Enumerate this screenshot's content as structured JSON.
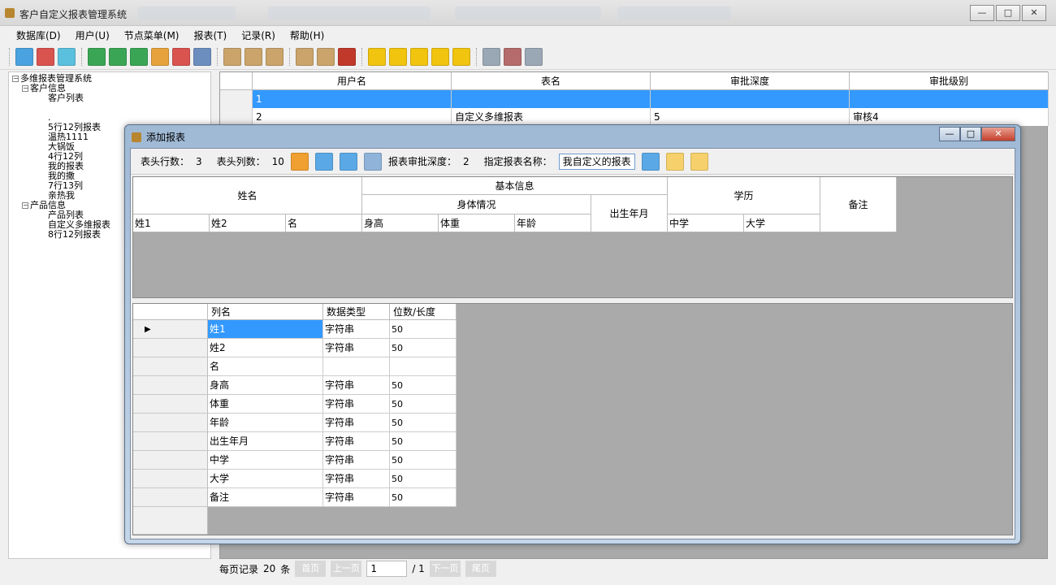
{
  "window": {
    "title": "客户自定义报表管理系统"
  },
  "menu": [
    "数据库(D)",
    "用户(U)",
    "节点菜单(M)",
    "报表(T)",
    "记录(R)",
    "帮助(H)"
  ],
  "toolbar_icons": [
    "add-table-icon",
    "delete-table-icon",
    "edit-table-icon",
    "add-node-icon",
    "add-child-node-icon",
    "add-sibling-node-icon",
    "move-node-icon",
    "delete-node-icon",
    "save-node-icon",
    "add-user-icon",
    "edit-user-icon",
    "delete-user-icon",
    "user-permission-icon",
    "user-role-icon",
    "import-icon",
    "report-add-icon",
    "report-edit-icon",
    "report-view-icon",
    "report-delete-icon",
    "report-export-icon",
    "db-connect-icon",
    "db-delete-icon",
    "db-edit-icon"
  ],
  "tree": {
    "root": "多维报表管理系统",
    "groups": [
      {
        "label": "客户信息",
        "items": [
          "客户列表",
          "",
          ".",
          "5行12列报表",
          "温热1111",
          "大锅饭",
          "4行12列",
          "我的报表",
          "我的撒",
          "7行13列",
          "亲热我"
        ]
      },
      {
        "label": "产品信息",
        "items": [
          "产品列表",
          "自定义多维报表",
          "8行12列报表"
        ]
      }
    ]
  },
  "main_grid": {
    "headers": [
      "用户名",
      "表名",
      "审批深度",
      "审批级别"
    ],
    "rows": [
      [
        "1",
        "",
        "",
        ""
      ],
      [
        "2",
        "自定义多维报表",
        "5",
        "审核4"
      ]
    ]
  },
  "pager": {
    "per_page_label": "每页记录",
    "per_page": "20",
    "unit": "条",
    "first": "首页",
    "prev": "上一页",
    "page": "1",
    "total": "/ 1",
    "next": "下一页",
    "last": "尾页"
  },
  "dialog": {
    "title": "添加报表",
    "rows_label": "表头行数：",
    "rows_value": "3",
    "cols_label": "表头列数：",
    "cols_value": "10",
    "depth_label": "报表审批深度：",
    "depth_value": "2",
    "name_label": "指定报表名称：",
    "name_value": "我自定义的报表",
    "header_preview": {
      "name": "姓名",
      "basic": "基本信息",
      "body": "身体情况",
      "birth": "出生年月",
      "edu": "学历",
      "note": "备注",
      "leaf": [
        "姓1",
        "姓2",
        "名",
        "身高",
        "体重",
        "年龄",
        "中学",
        "大学"
      ]
    },
    "columns_grid": {
      "headers": [
        "列名",
        "数据类型",
        "位数/长度"
      ],
      "rows": [
        [
          "姓1",
          "字符串",
          "50"
        ],
        [
          "姓2",
          "字符串",
          "50"
        ],
        [
          "名",
          "",
          ""
        ],
        [
          "身高",
          "字符串",
          "50"
        ],
        [
          "体重",
          "字符串",
          "50"
        ],
        [
          "年龄",
          "字符串",
          "50"
        ],
        [
          "出生年月",
          "字符串",
          "50"
        ],
        [
          "中学",
          "字符串",
          "50"
        ],
        [
          "大学",
          "字符串",
          "50"
        ],
        [
          "备注",
          "字符串",
          "50"
        ]
      ]
    }
  }
}
